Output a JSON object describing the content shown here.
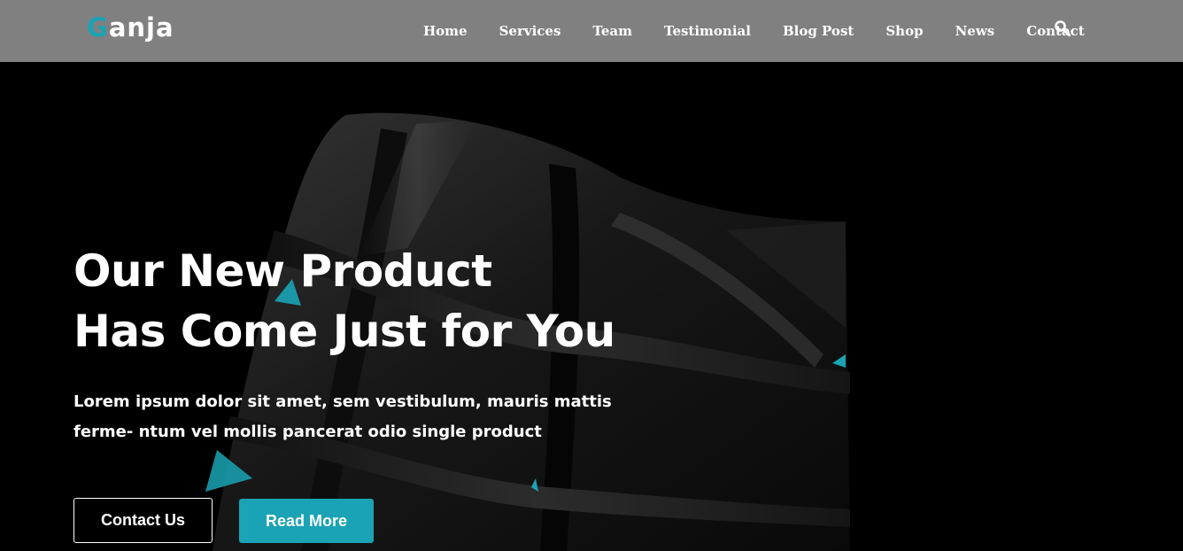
{
  "header": {
    "logo_first": "G",
    "logo_rest": "anja",
    "nav": [
      "Home",
      "Services",
      "Team",
      "Testimonial",
      "Blog Post",
      "Shop",
      "News",
      "Contact"
    ],
    "search_icon": "search-icon"
  },
  "hero": {
    "title_line1": "Our New Product",
    "title_line2": "Has Come Just for You",
    "text": "Lorem ipsum dolor sit amet, sem vestibulum, mauris mattis ferme- ntum vel mollis pancerat odio single product",
    "contact_label": "Contact Us",
    "read_more_label": "Read More"
  },
  "colors": {
    "header_bg": "#808080",
    "accent": "#1aa3b5",
    "hero_bg": "#000000",
    "text": "#ffffff"
  }
}
